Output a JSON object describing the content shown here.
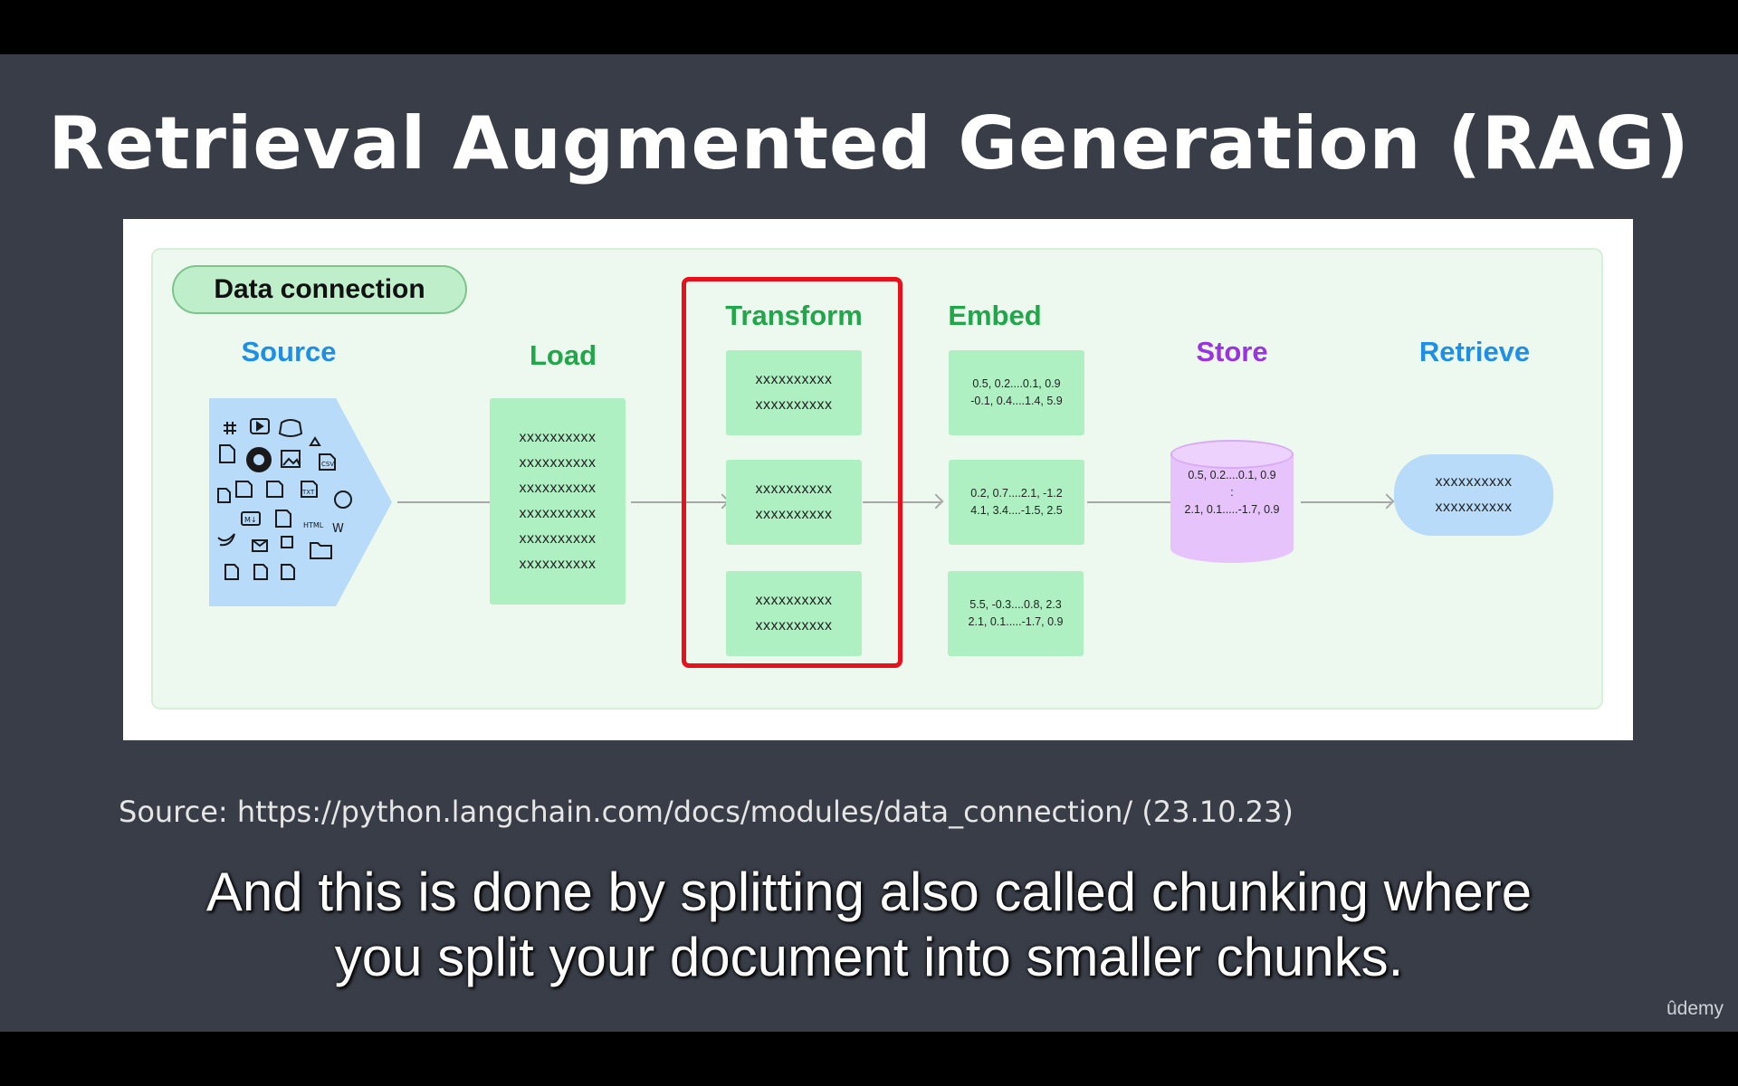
{
  "slide": {
    "title": "Retrieval Augmented Generation (RAG)",
    "source_note": "Source: https://python.langchain.com/docs/modules/data_connection/ (23.10.23)",
    "caption_line1": "And this is done by splitting also called chunking where",
    "caption_line2": "you split your document into smaller chunks.",
    "watermark": "ûdemy"
  },
  "diagram": {
    "badge": "Data connection",
    "labels": {
      "source": "Source",
      "load": "Load",
      "transform": "Transform",
      "embed": "Embed",
      "store": "Store",
      "retrieve": "Retrieve"
    },
    "load_lines": [
      "xxxxxxxxxx",
      "xxxxxxxxxx",
      "xxxxxxxxxx",
      "xxxxxxxxxx",
      "xxxxxxxxxx",
      "xxxxxxxxxx"
    ],
    "transform_chunks": [
      [
        "xxxxxxxxxx",
        "xxxxxxxxxx"
      ],
      [
        "xxxxxxxxxx",
        "xxxxxxxxxx"
      ],
      [
        "xxxxxxxxxx",
        "xxxxxxxxxx"
      ]
    ],
    "embed_vectors": [
      [
        "0.5, 0.2....0.1, 0.9",
        "-0.1, 0.4....1.4, 5.9"
      ],
      [
        "0.2, 0.7....2.1, -1.2",
        "4.1, 3.4....-1.5, 2.5"
      ],
      [
        "5.5, -0.3....0.8, 2.3",
        "2.1, 0.1.....-1.7, 0.9"
      ]
    ],
    "store_lines": [
      "0.5, 0.2....0.1, 0.9",
      ":",
      "2.1, 0.1.....-1.7, 0.9"
    ],
    "retrieve_lines": [
      "xxxxxxxxxx",
      "xxxxxxxxxx"
    ]
  },
  "colors": {
    "slide_bg": "#393d47",
    "diagram_bg": "#edf9ee",
    "chunk_green": "#aef0c2",
    "source_blue": "#b7dbf8",
    "store_purple": "#e6c4fb",
    "highlight_red": "#e8111b"
  }
}
